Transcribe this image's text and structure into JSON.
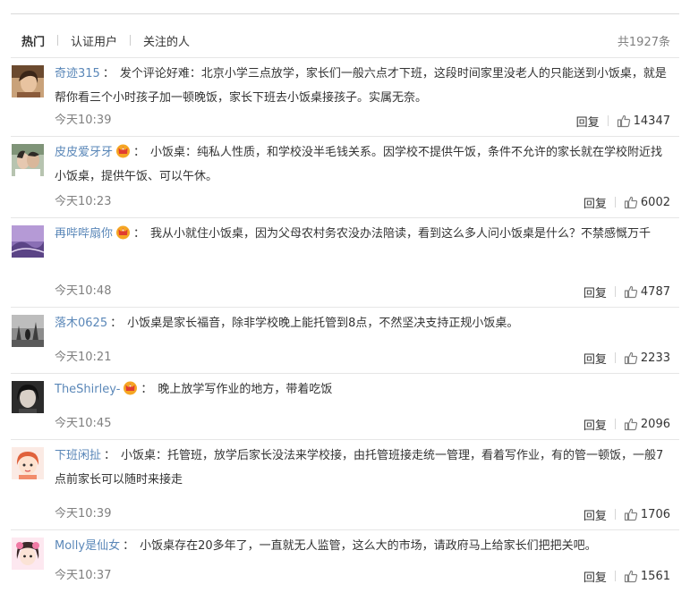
{
  "tabs": [
    {
      "label": "热门",
      "active": true
    },
    {
      "label": "认证用户",
      "active": false
    },
    {
      "label": "关注的人",
      "active": false
    }
  ],
  "total_label": "共1927条",
  "reply_label": "回复",
  "colors": {
    "username": "#5a87b8",
    "muted": "#808080",
    "text": "#333333",
    "crown": "#f5a623"
  },
  "comments": [
    {
      "user": "奇迹315",
      "crown": false,
      "text": "发个评论好难：北京小学三点放学，家长们一般六点才下班，这段时间家里没老人的只能送到小饭桌，就是帮你看三个小时孩子加一顿晚饭，家长下班去小饭桌接孩子。实属无奈。",
      "time": "今天10:39",
      "likes": "14347",
      "avatar": "girl-portrait"
    },
    {
      "user": "皮皮爱牙牙",
      "crown": true,
      "text": "小饭桌：纯私人性质，和学校没半毛钱关系。因学校不提供午饭，条件不允许的家长就在学校附近找小饭桌，提供午饭、可以午休。",
      "time": "今天10:23",
      "likes": "6002",
      "avatar": "couple-photo"
    },
    {
      "user": "再哔哔扇你",
      "crown": true,
      "text": "我从小就住小饭桌，因为父母农村务农没办法陪读，看到这么多人问小饭桌是什么？不禁感慨万千",
      "time": "今天10:48",
      "likes": "4787",
      "avatar": "purple-abstract"
    },
    {
      "user": "落木0625",
      "crown": false,
      "text": "小饭桌是家长福音，除非学校晚上能托管到8点，不然坚决支持正规小饭桌。",
      "time": "今天10:21",
      "likes": "2233",
      "avatar": "gray-street"
    },
    {
      "user": "TheShirley-",
      "crown": true,
      "text": "晚上放学写作业的地方，带着吃饭",
      "time": "今天10:45",
      "likes": "2096",
      "avatar": "dark-portrait"
    },
    {
      "user": "下班闲扯",
      "crown": false,
      "text": "小饭桌：托管班，放学后家长没法来学校接，由托管班接走统一管理，看着写作业，有的管一顿饭，一般7点前家长可以随时来接走",
      "time": "今天10:39",
      "likes": "1706",
      "avatar": "cartoon-girl"
    },
    {
      "user": "Molly是仙女",
      "crown": false,
      "text": "小饭桌存在20多年了，一直就无人监管，这么大的市场，请政府马上给家长们把把关吧。",
      "time": "今天10:37",
      "likes": "1561",
      "avatar": "pink-girl"
    }
  ]
}
